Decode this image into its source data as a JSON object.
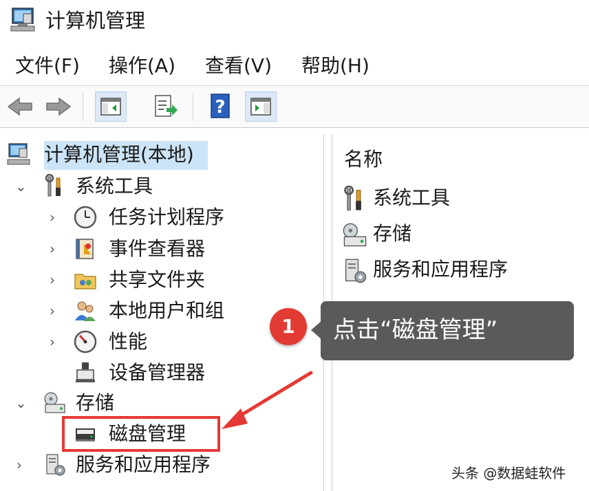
{
  "window": {
    "title": "计算机管理"
  },
  "menu": [
    "文件(F)",
    "操作(A)",
    "查看(V)",
    "帮助(H)"
  ],
  "toolbar": {
    "buttons": [
      "back-icon",
      "forward-icon",
      "show-hide-console-tree-icon",
      "export-list-icon",
      "help-icon",
      "show-hide-action-pane-icon"
    ]
  },
  "tree": {
    "root": "计算机管理(本地)",
    "system_tools": {
      "label": "系统工具",
      "children": [
        "任务计划程序",
        "事件查看器",
        "共享文件夹",
        "本地用户和组",
        "性能",
        "设备管理器"
      ]
    },
    "storage": {
      "label": "存储",
      "children": [
        "磁盘管理"
      ]
    },
    "services": "服务和应用程序"
  },
  "right_pane": {
    "header": "名称",
    "items": [
      "系统工具",
      "存储",
      "服务和应用程序"
    ]
  },
  "callout": {
    "badge": "1",
    "text": "点击“磁盘管理”"
  },
  "watermark": "头条 @数据蛙软件",
  "colors": {
    "highlight": "#e53935",
    "callout_bg": "#5a5a5a",
    "badge": "#e23b33",
    "selection": "#cce4f7"
  }
}
